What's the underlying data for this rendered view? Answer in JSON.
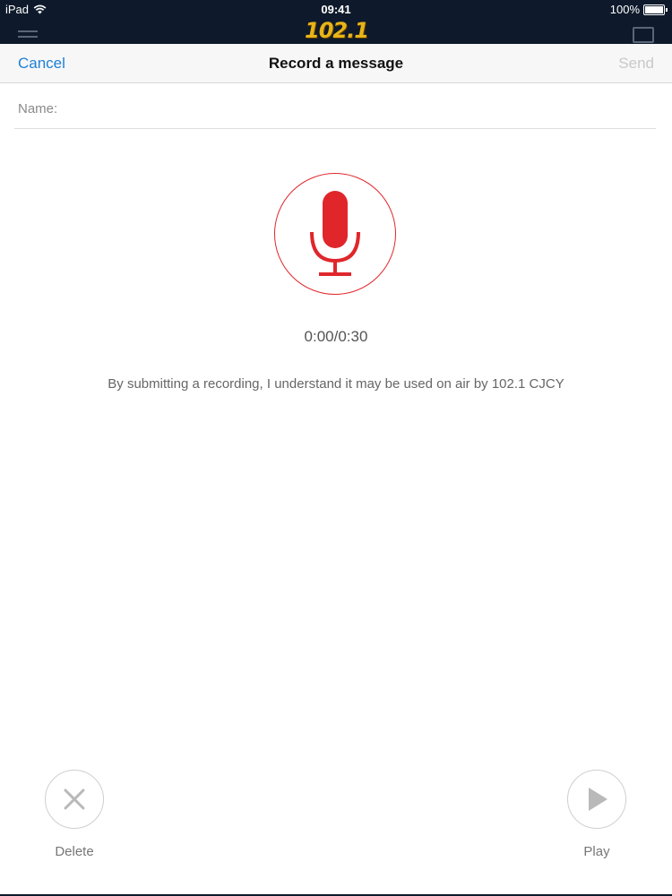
{
  "status_bar": {
    "device": "iPad",
    "time": "09:41",
    "battery": "100%"
  },
  "background_app": {
    "logo_text": "102.1",
    "logo_color": "#e8b417"
  },
  "navbar": {
    "cancel_label": "Cancel",
    "title": "Record a message",
    "send_label": "Send"
  },
  "name_field": {
    "label": "Name:",
    "value": ""
  },
  "recorder": {
    "mic_icon": "microphone-icon",
    "timer": "0:00/0:30",
    "disclaimer": "By submitting a recording, I understand it may be used on air by 102.1 CJCY",
    "accent_color": "#e0262b"
  },
  "controls": {
    "delete": {
      "icon": "close-icon",
      "label": "Delete"
    },
    "play": {
      "icon": "play-icon",
      "label": "Play"
    }
  }
}
